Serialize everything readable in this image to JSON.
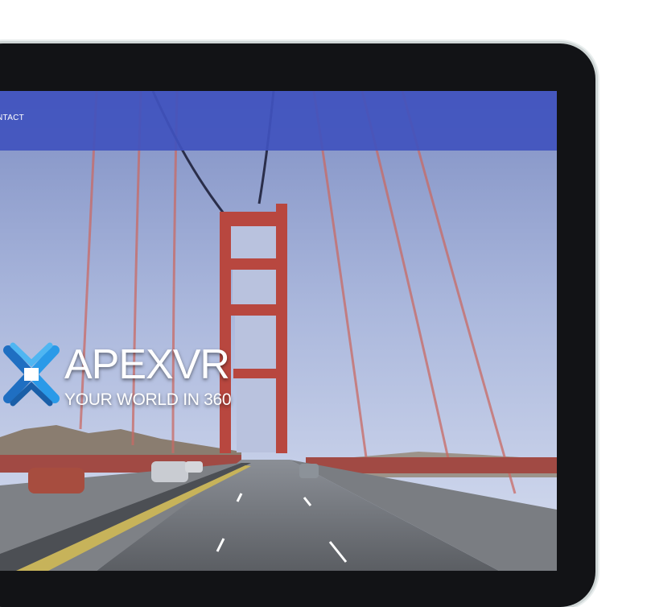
{
  "nav": {
    "contact_label": "NTACT"
  },
  "brand": {
    "name": "APEXVR",
    "tagline": "YOUR WORLD IN 360"
  },
  "colors": {
    "nav_bar": "#4052be",
    "bezel": "#121316",
    "bridge": "#b8473f",
    "logo_blue": "#2a8fe0"
  },
  "icons": {
    "logo": "apexvr-logo-icon"
  }
}
